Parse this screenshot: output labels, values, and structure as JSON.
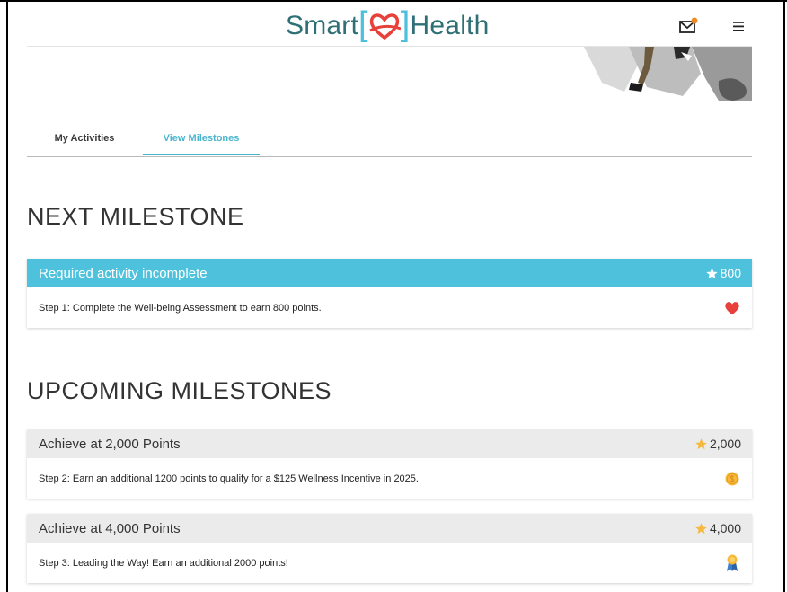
{
  "header": {
    "logo_left": "Smart",
    "logo_right": "ealth",
    "logo_h": "H"
  },
  "tabs": [
    {
      "label": "My Activities"
    },
    {
      "label": "View Milestones"
    }
  ],
  "next": {
    "section_title": "NEXT MILESTONE",
    "card": {
      "title": "Required activity incomplete",
      "points": "800",
      "step": "Step 1: Complete the Well-being Assessment to earn 800 points.",
      "icon": "heart-icon"
    }
  },
  "upcoming": {
    "section_title": "UPCOMING MILESTONES",
    "cards": [
      {
        "title": "Achieve at 2,000 Points",
        "points": "2,000",
        "step": "Step 2: Earn an additional 1200 points to qualify for a $125 Wellness Incentive in 2025.",
        "icon": "coin-icon"
      },
      {
        "title": "Achieve at 4,000 Points",
        "points": "4,000",
        "step": "Step 3: Leading the Way! Earn an additional 2000 points!",
        "icon": "ribbon-icon"
      }
    ]
  },
  "colors": {
    "accent": "#4ec1dc",
    "heart": "#e8403a",
    "star_gold": "#f6b93b",
    "logo_text": "#2f6f76"
  }
}
